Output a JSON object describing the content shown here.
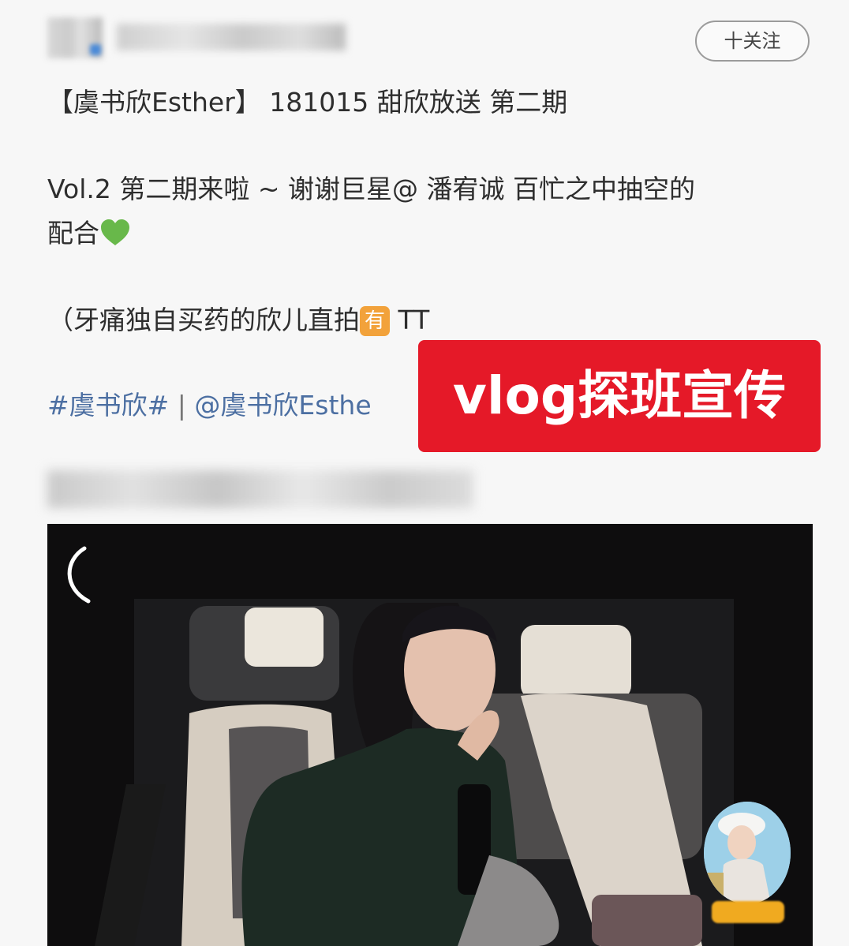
{
  "header": {
    "follow_label": "十关注"
  },
  "post": {
    "title": "【虞书欣Esther】 181015  甜欣放送 第二期",
    "vol_line": "Vol.2 第二期来啦 ~ 谢谢巨星@ 潘宥诚 百忙之中抽空的",
    "vol_line2": "配合",
    "note_before": "（牙痛独自买药的欣儿直拍",
    "badge_text": "有",
    "note_after": " TT",
    "hashtag": "#虞书欣#",
    "separator": " | ",
    "mention": "@虞书欣Esthe"
  },
  "banner": {
    "text": "vlog探班宣传"
  },
  "colors": {
    "banner_bg": "#e51928",
    "link": "#4c6fa2",
    "badge": "#f2a23b",
    "heart": "#68b84a"
  },
  "icons": [
    "heart-emoji-icon",
    "loading-spinner-icon"
  ]
}
